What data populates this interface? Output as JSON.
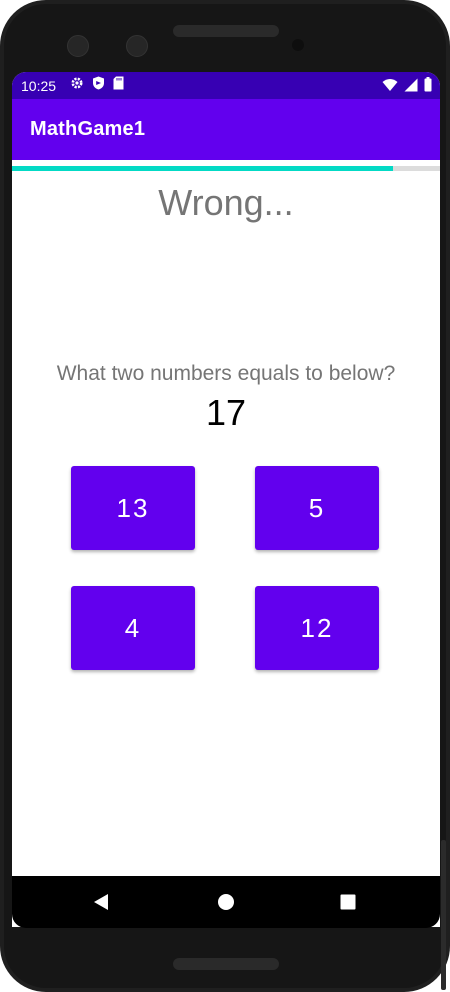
{
  "status": {
    "time": "10:25",
    "left_icons": [
      "gear-icon",
      "shield-icon",
      "sd-card-icon"
    ],
    "right_icons": [
      "wifi-icon",
      "signal-icon",
      "battery-icon"
    ]
  },
  "appbar": {
    "title": "MathGame1"
  },
  "progress": {
    "value_percent": 89
  },
  "game": {
    "result_text": "Wrong...",
    "question": "What two numbers equals to below?",
    "target": "17",
    "answers": [
      "13",
      "5",
      "4",
      "12"
    ]
  },
  "navigation": {
    "buttons": [
      "back-icon",
      "home-icon",
      "recents-icon"
    ]
  },
  "colors": {
    "status_bar": "#3700b3",
    "primary": "#6200ee",
    "accent": "#03dac5",
    "text_secondary": "#757575"
  }
}
